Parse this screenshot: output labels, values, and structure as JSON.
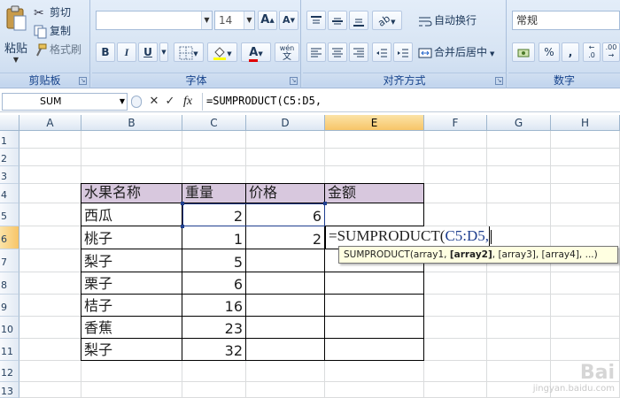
{
  "ribbon": {
    "clipboard": {
      "label": "剪贴板",
      "paste": "粘贴",
      "cut": "剪切",
      "copy": "复制",
      "format_painter": "格式刷"
    },
    "font": {
      "label": "字体",
      "font_name": "",
      "font_size": "14",
      "bold": "B",
      "italic": "I",
      "underline": "U",
      "phonetic": "wén"
    },
    "alignment": {
      "label": "对齐方式",
      "wrap_text": "自动换行",
      "merge_center": "合并后居中"
    },
    "number": {
      "label": "数字",
      "format": "常规",
      "percent": "%",
      "comma": ","
    }
  },
  "formula_bar": {
    "name_box": "SUM",
    "cancel": "✕",
    "enter": "✓",
    "fx": "fx",
    "formula": "=SUMPRODUCT(C5:D5,"
  },
  "columns": [
    "A",
    "B",
    "C",
    "D",
    "E",
    "F",
    "G",
    "H"
  ],
  "rows": [
    "1",
    "2",
    "3",
    "4",
    "5",
    "6",
    "7",
    "8",
    "9",
    "10",
    "11",
    "12",
    "13"
  ],
  "table": {
    "headers": [
      "水果名称",
      "重量",
      "价格",
      "金额"
    ],
    "rows": [
      {
        "name": "西瓜",
        "weight": "2",
        "price": "6"
      },
      {
        "name": "桃子",
        "weight": "1",
        "price": "2"
      },
      {
        "name": "梨子",
        "weight": "5",
        "price": ""
      },
      {
        "name": "栗子",
        "weight": "6",
        "price": ""
      },
      {
        "name": "桔子",
        "weight": "16",
        "price": ""
      },
      {
        "name": "香蕉",
        "weight": "23",
        "price": ""
      },
      {
        "name": "梨子",
        "weight": "32",
        "price": ""
      }
    ]
  },
  "editing_cell": {
    "text_prefix": "=SUMPRODUCT(",
    "text_ref": "C5:D5,",
    "address": "E6"
  },
  "tooltip": {
    "fn": "SUMPRODUCT(array1, ",
    "current": "[array2]",
    "rest": ", [array3], [array4], ...)"
  },
  "watermark": {
    "line1": "Bai",
    "line2": "jingyan.baidu.com"
  }
}
